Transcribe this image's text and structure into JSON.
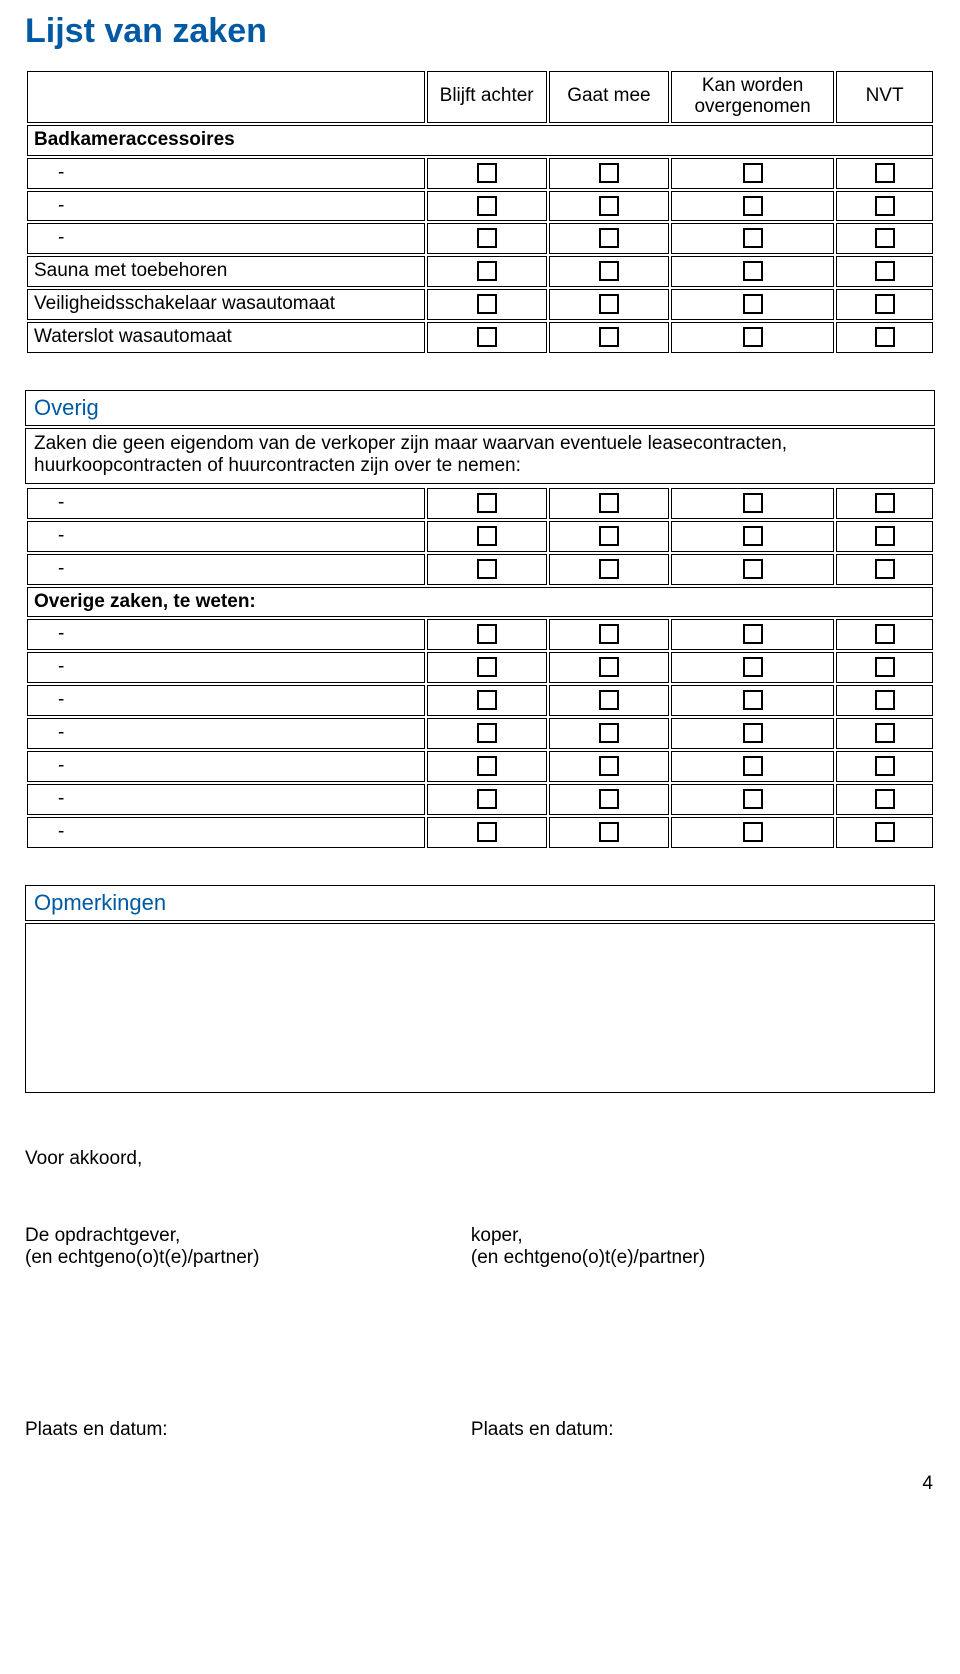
{
  "title": "Lijst van zaken",
  "columns": {
    "col1": "Blijft achter",
    "col2": "Gaat mee",
    "col3": "Kan worden overgenomen",
    "col4": "NVT"
  },
  "section1": {
    "group": "Badkameraccessoires",
    "blank1": "-",
    "blank2": "-",
    "blank3": "-",
    "row_sauna": "Sauna met toebehoren",
    "row_veiligheid": "Veiligheidsschakelaar wasautomaat",
    "row_waterslot": "Waterslot wasautomaat"
  },
  "overig": {
    "heading": "Overig",
    "intro": "Zaken die geen eigendom van de verkoper zijn maar waarvan eventuele leasecontracten, huurkoopcontracten of huurcontracten zijn over te nemen:",
    "blank1": "-",
    "blank2": "-",
    "blank3": "-",
    "group2": "Overige zaken, te weten:",
    "g2b1": "-",
    "g2b2": "-",
    "g2b3": "-",
    "g2b4": "-",
    "g2b5": "-",
    "g2b6": "-",
    "g2b7": "-"
  },
  "opmerkingen_heading": "Opmerkingen",
  "sign": {
    "voor_akkoord": "Voor akkoord,",
    "opdrachtgever": "De opdrachtgever,",
    "koper": "koper,",
    "partner": "(en echtgeno(o)t(e)/partner)",
    "plaats": "Plaats en datum:"
  },
  "page_number": "4"
}
